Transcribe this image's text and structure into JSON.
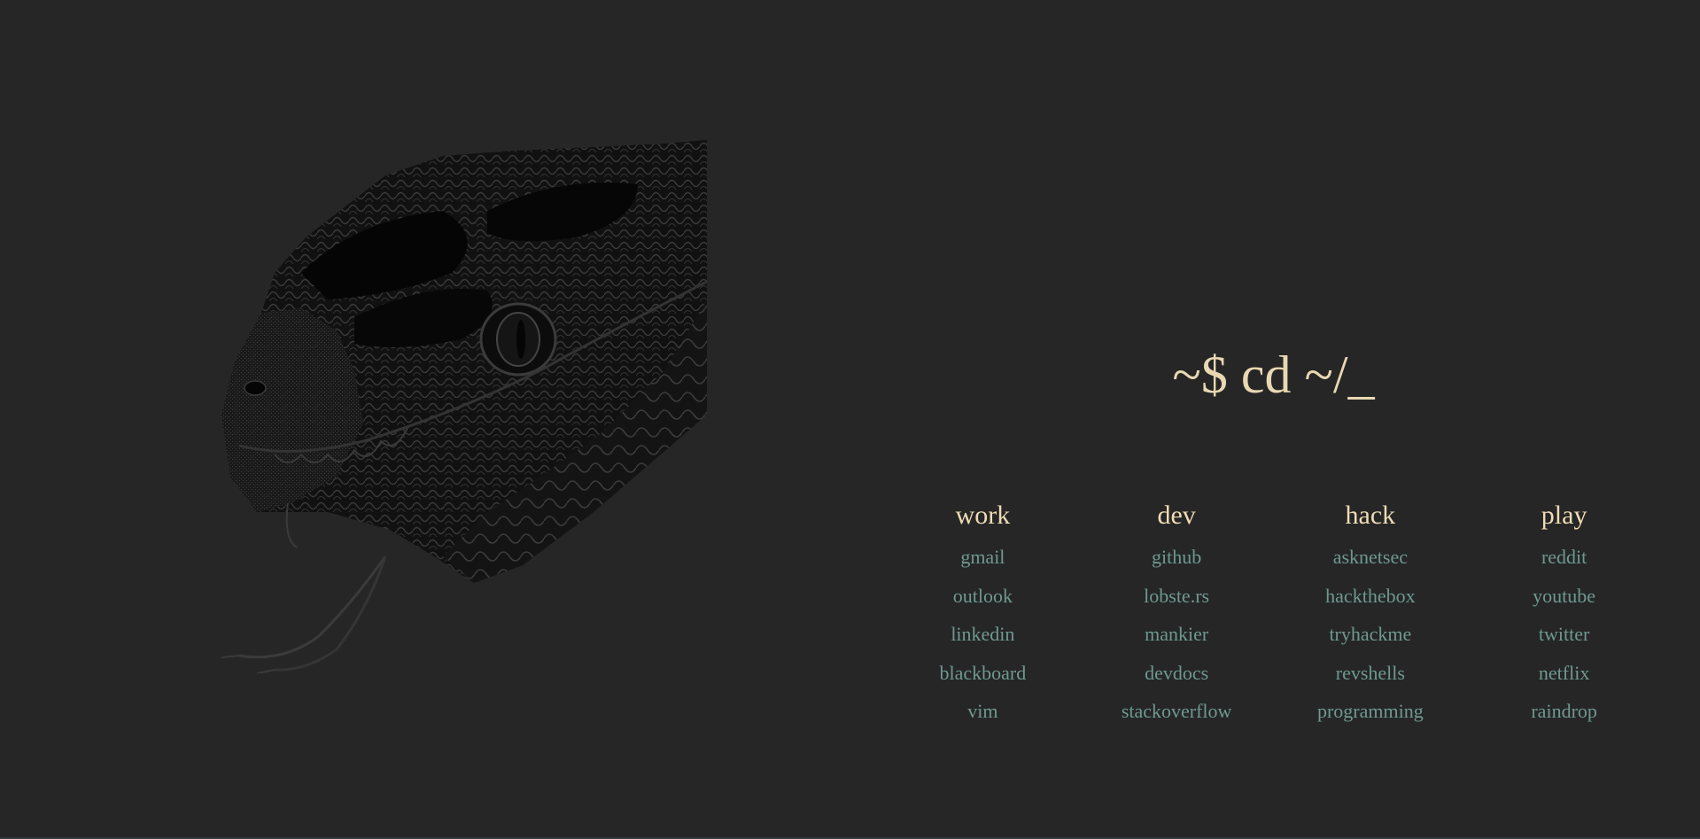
{
  "prompt": "~$ cd ~/_",
  "accent_colors": {
    "background": "#262626",
    "heading": "#e8d8b2",
    "link": "#6e9990"
  },
  "image": {
    "icon": "snake-head-illustration"
  },
  "columns": [
    {
      "title": "work",
      "links": [
        "gmail",
        "outlook",
        "linkedin",
        "blackboard",
        "vim"
      ]
    },
    {
      "title": "dev",
      "links": [
        "github",
        "lobste.rs",
        "mankier",
        "devdocs",
        "stackoverflow"
      ]
    },
    {
      "title": "hack",
      "links": [
        "asknetsec",
        "hackthebox",
        "tryhackme",
        "revshells",
        "programming"
      ]
    },
    {
      "title": "play",
      "links": [
        "reddit",
        "youtube",
        "twitter",
        "netflix",
        "raindrop"
      ]
    }
  ]
}
